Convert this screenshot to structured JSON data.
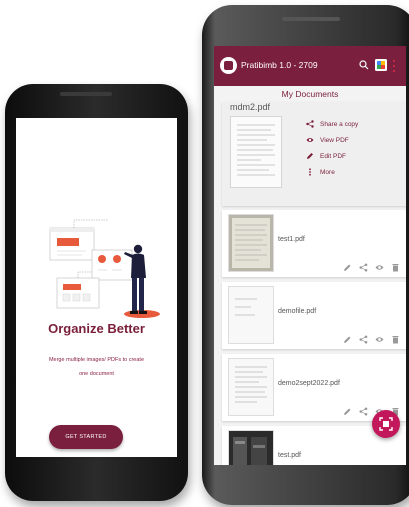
{
  "left_screen": {
    "title": "Organize Better",
    "subtitle_line1": "Merge multiple images/ PDFs to create",
    "subtitle_line2": "one document",
    "cta_label": "GET STARTED"
  },
  "right_screen": {
    "app_title": "Pratibimb 1.0 - 2709",
    "section_title": "My Documents",
    "expanded_doc": {
      "name": "mdm2.pdf",
      "menu": [
        {
          "label": "Share a copy",
          "icon": "share-icon"
        },
        {
          "label": "View PDF",
          "icon": "eye-icon"
        },
        {
          "label": "Edit PDF",
          "icon": "pencil-icon"
        },
        {
          "label": "More",
          "icon": "more-vertical-icon"
        }
      ]
    },
    "documents": [
      {
        "name": "test1.pdf"
      },
      {
        "name": "demofile.pdf"
      },
      {
        "name": "demo2sept2022.pdf"
      },
      {
        "name": "test.pdf"
      }
    ]
  },
  "colors": {
    "brand": "#7b1f3f",
    "fab": "#c2185b",
    "accent": "#e85a3c"
  }
}
